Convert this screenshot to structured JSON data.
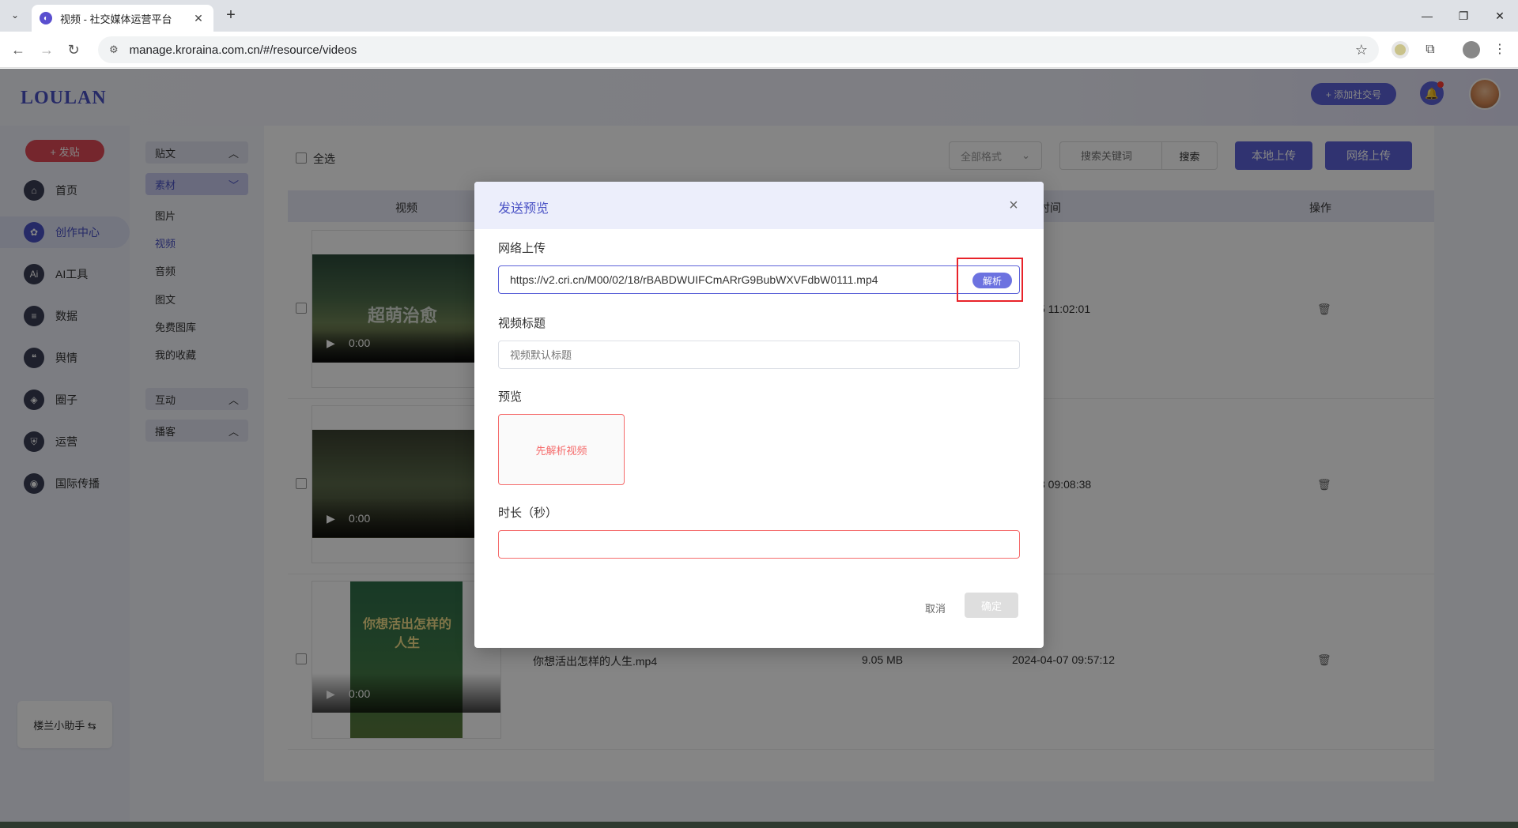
{
  "browser": {
    "tab_title": "视频 - 社交媒体运营平台",
    "url": "manage.kroraina.com.cn/#/resource/videos"
  },
  "app": {
    "logo": "LOULAN",
    "add_account": "+ 添加社交号",
    "post_button": "+ 发贴",
    "assistant": "楼兰小助手 ⇆"
  },
  "nav": [
    {
      "label": "首页",
      "icon": "home-icon"
    },
    {
      "label": "创作中心",
      "icon": "palette-icon"
    },
    {
      "label": "AI工具",
      "icon": "ai-icon"
    },
    {
      "label": "数据",
      "icon": "database-icon"
    },
    {
      "label": "舆情",
      "icon": "quote-icon"
    },
    {
      "label": "圈子",
      "icon": "compass-icon"
    },
    {
      "label": "运营",
      "icon": "shield-icon"
    },
    {
      "label": "国际传播",
      "icon": "globe-icon"
    }
  ],
  "subnav": {
    "groups": [
      "贴文",
      "素材",
      "互动",
      "播客"
    ],
    "items": [
      "图片",
      "视频",
      "音频",
      "图文",
      "免费图库",
      "我的收藏"
    ]
  },
  "toolbar": {
    "select_all": "全选",
    "format": "全部格式",
    "search_placeholder": "搜索关键词",
    "search_btn": "搜索",
    "local_upload": "本地上传",
    "web_upload": "网络上传"
  },
  "table": {
    "headers": [
      "视频",
      "时间",
      "操作"
    ],
    "rows": [
      {
        "name": "",
        "size": "",
        "time": "5 11:02:01",
        "video_time": "0:00",
        "overlay_text": "超萌治愈"
      },
      {
        "name": "",
        "size": "",
        "time": "8 09:08:38",
        "video_time": "0:00",
        "overlay_text": ""
      },
      {
        "name": "你想活出怎样的人生.mp4",
        "size": "9.05 MB",
        "time": "2024-04-07 09:57:12",
        "video_time": "0:00",
        "overlay_text": "你想活出怎样的人生"
      }
    ]
  },
  "dialog": {
    "title": "发送预览",
    "url_label": "网络上传",
    "url_value": "https://v2.cri.cn/M00/02/18/rBABDWUIFCmARrG9BubWXVFdbW0111.mp4",
    "parse_btn": "解析",
    "video_title_label": "视频标题",
    "video_title_placeholder": "视频默认标题",
    "preview_label": "预览",
    "preview_hint": "先解析视频",
    "duration_label": "时长（秒）",
    "cancel": "取消",
    "confirm": "确定"
  }
}
